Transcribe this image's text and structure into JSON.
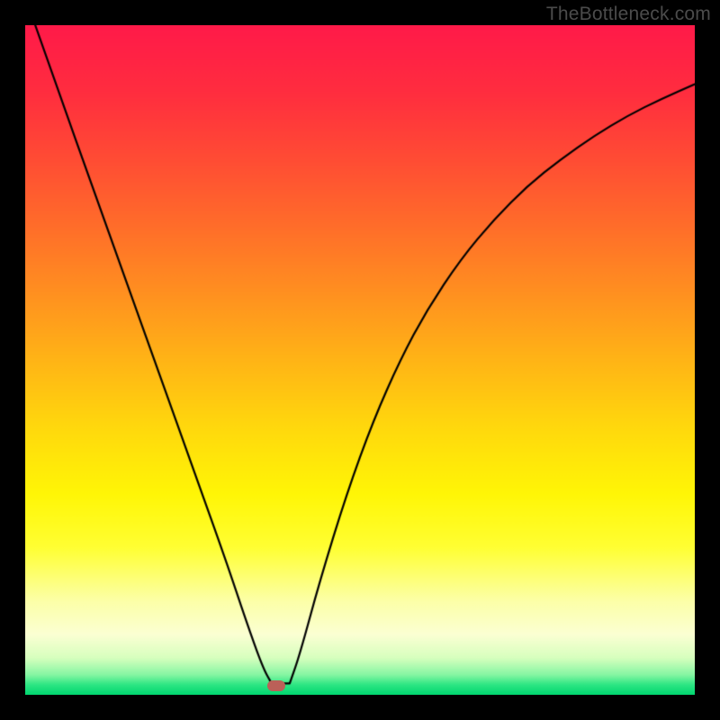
{
  "watermark": "TheBottleneck.com",
  "marker": {
    "x_frac": 0.375,
    "y_frac": 0.987,
    "color": "#bb6058"
  },
  "gradient_stops": [
    {
      "offset": 0.0,
      "color": "#ff1a49"
    },
    {
      "offset": 0.1,
      "color": "#ff2d3f"
    },
    {
      "offset": 0.2,
      "color": "#ff4c34"
    },
    {
      "offset": 0.3,
      "color": "#ff6d2a"
    },
    {
      "offset": 0.4,
      "color": "#ff9020"
    },
    {
      "offset": 0.5,
      "color": "#ffb416"
    },
    {
      "offset": 0.6,
      "color": "#ffd80d"
    },
    {
      "offset": 0.7,
      "color": "#fff606"
    },
    {
      "offset": 0.78,
      "color": "#ffff33"
    },
    {
      "offset": 0.86,
      "color": "#fcffa8"
    },
    {
      "offset": 0.91,
      "color": "#fbffd3"
    },
    {
      "offset": 0.945,
      "color": "#d7ffbe"
    },
    {
      "offset": 0.97,
      "color": "#86f6a3"
    },
    {
      "offset": 0.985,
      "color": "#2de683"
    },
    {
      "offset": 1.0,
      "color": "#00d670"
    }
  ],
  "chart_data": {
    "type": "line",
    "title": "",
    "xlabel": "",
    "ylabel": "",
    "xlim": [
      0,
      1
    ],
    "ylim": [
      0,
      1
    ],
    "series": [
      {
        "name": "left-branch",
        "x": [
          0.015,
          0.05,
          0.1,
          0.15,
          0.2,
          0.25,
          0.3,
          0.33,
          0.355,
          0.368
        ],
        "y": [
          1.0,
          0.9,
          0.76,
          0.62,
          0.48,
          0.34,
          0.2,
          0.11,
          0.04,
          0.017
        ]
      },
      {
        "name": "right-branch",
        "x": [
          0.395,
          0.41,
          0.44,
          0.48,
          0.52,
          0.56,
          0.6,
          0.65,
          0.7,
          0.75,
          0.8,
          0.85,
          0.9,
          0.95,
          1.0
        ],
        "y": [
          0.017,
          0.06,
          0.17,
          0.3,
          0.41,
          0.5,
          0.575,
          0.65,
          0.71,
          0.76,
          0.8,
          0.835,
          0.865,
          0.89,
          0.912
        ]
      },
      {
        "name": "bottom-flat",
        "x": [
          0.368,
          0.395
        ],
        "y": [
          0.017,
          0.017
        ]
      }
    ],
    "annotations": []
  }
}
